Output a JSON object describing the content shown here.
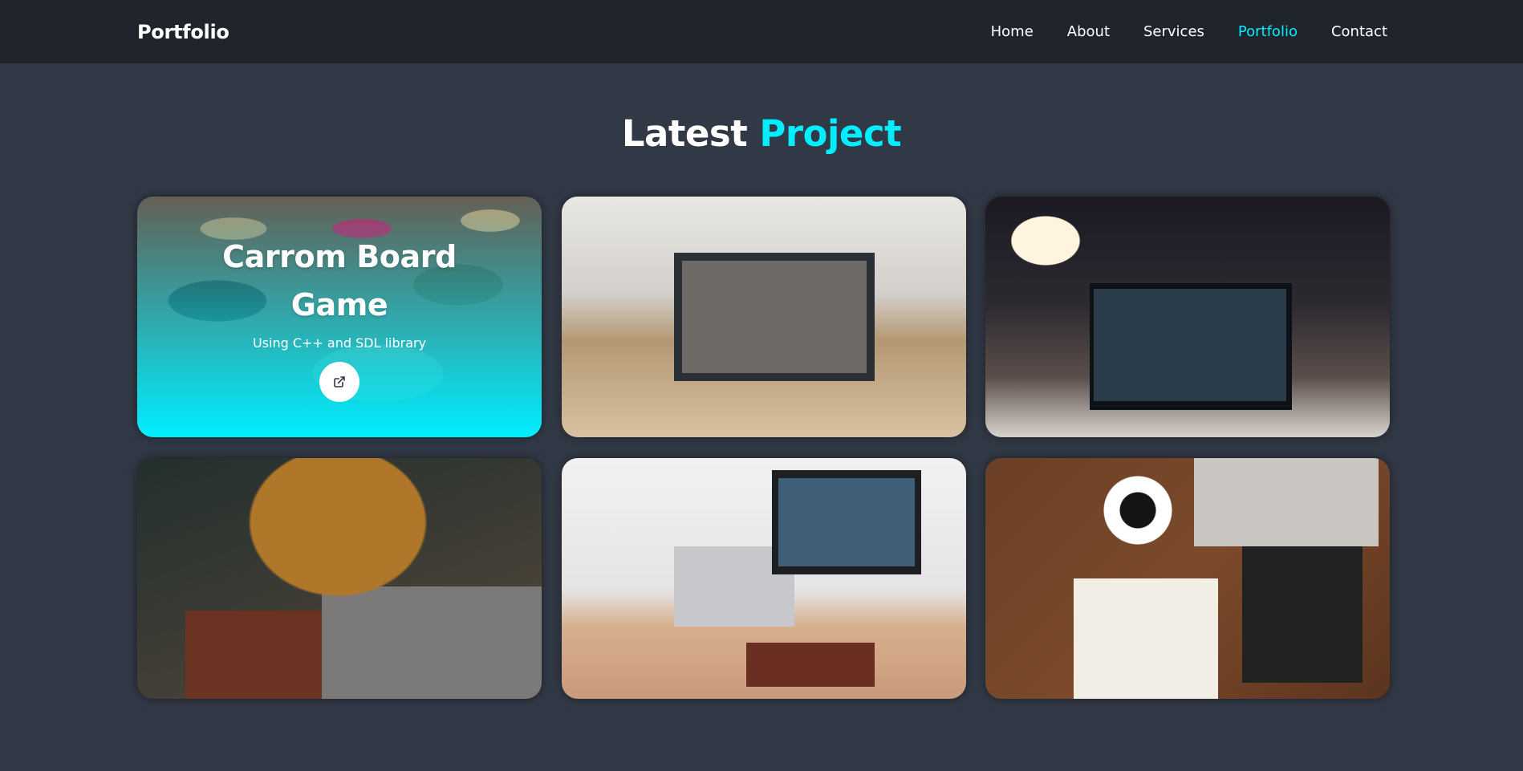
{
  "header": {
    "brand": "Portfolio",
    "nav": [
      {
        "label": "Home",
        "active": false
      },
      {
        "label": "About",
        "active": false
      },
      {
        "label": "Services",
        "active": false
      },
      {
        "label": "Portfolio",
        "active": true
      },
      {
        "label": "Contact",
        "active": false
      }
    ]
  },
  "section": {
    "title_plain": "Latest",
    "title_accent": "Project"
  },
  "projects": [
    {
      "title": "Carrom Board Game",
      "description": "Using C++ and SDL library",
      "link_icon": "external-link-icon",
      "image": "carrom-board-photo"
    },
    {
      "image": "laptop-trading-chart-photo"
    },
    {
      "image": "desk-lamp-laptop-photo"
    },
    {
      "image": "person-typing-laptop-photo"
    },
    {
      "image": "imac-desk-workspace-photo"
    },
    {
      "image": "desk-notebook-coffee-tablet-photo"
    }
  ],
  "colors": {
    "accent": "#00eeff",
    "background": "#323946",
    "navbar": "#1f242d",
    "text": "#ffffff"
  }
}
